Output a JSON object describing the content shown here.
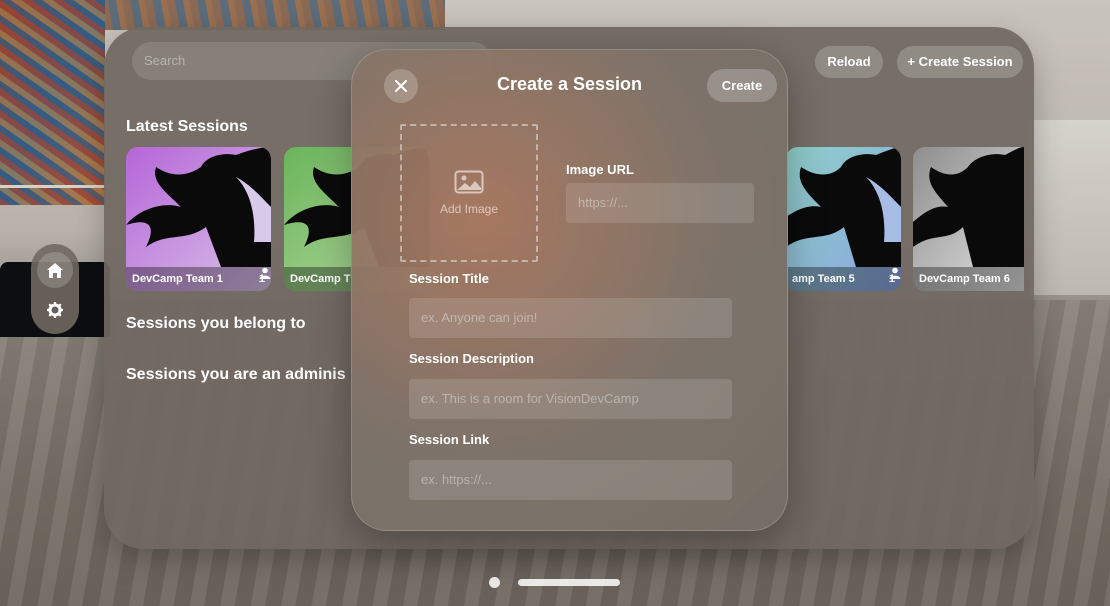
{
  "main": {
    "search_placeholder": "Search",
    "reload_label": "Reload",
    "create_session_label": "+ Create Session",
    "latest_heading": "Latest Sessions",
    "belong_heading": "Sessions you belong to",
    "admin_heading": "Sessions you are an adminis",
    "cards": [
      {
        "title": "DevCamp Team 1",
        "count": "1",
        "gradient": [
          "#b565d8",
          "#d9c3e8"
        ]
      },
      {
        "title": "DevCamp T",
        "count": "",
        "gradient": [
          "#6ab45a",
          "#b9dca3"
        ]
      },
      {
        "title": "amp Team 5",
        "count": "1",
        "gradient": [
          "#8fd0c8",
          "#8aa4e0"
        ]
      },
      {
        "title": "DevCamp Team 6",
        "count": "",
        "gradient": [
          "#8d8d8d",
          "#e4e4e4"
        ]
      }
    ]
  },
  "ornament": {
    "home_icon": "house-icon",
    "settings_icon": "gear-icon"
  },
  "modal": {
    "title": "Create a Session",
    "create_label": "Create",
    "add_image_label": "Add Image",
    "image_url_label": "Image URL",
    "image_url_placeholder": "https://...",
    "session_title_label": "Session Title",
    "session_title_placeholder": "ex. Anyone can join!",
    "session_description_label": "Session Description",
    "session_description_placeholder": "ex. This is a room for VisionDevCamp",
    "session_link_label": "Session Link",
    "session_link_placeholder": "ex. https://..."
  }
}
